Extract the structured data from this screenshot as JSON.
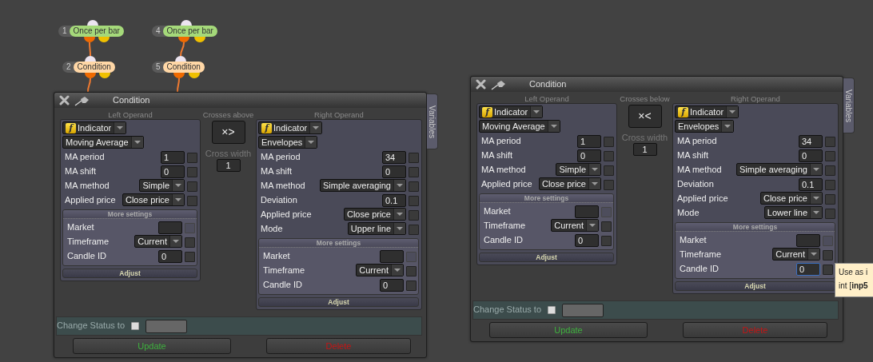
{
  "nodes": [
    {
      "number": "1",
      "label": "Once per bar",
      "kind": "trigger"
    },
    {
      "number": "2",
      "label": "Condition",
      "kind": "condition"
    },
    {
      "number": "4",
      "label": "Once per bar",
      "kind": "trigger"
    },
    {
      "number": "5",
      "label": "Condition",
      "kind": "condition"
    }
  ],
  "windows": [
    {
      "title": "Condition",
      "side_tab": "Variables",
      "left_operand": {
        "heading": "Left Operand",
        "source": {
          "icon": "f",
          "value": "Indicator"
        },
        "indicator": "Moving Average",
        "params": [
          {
            "label": "MA period",
            "kind": "number",
            "value": "1",
            "checked": false
          },
          {
            "label": "MA shift",
            "kind": "number",
            "value": "0",
            "checked": false
          },
          {
            "label": "MA method",
            "kind": "select",
            "value": "Simple",
            "checked": false
          },
          {
            "label": "Applied price",
            "kind": "select",
            "value": "Close price",
            "checked": false
          }
        ],
        "more_settings": {
          "heading": "More settings",
          "params": [
            {
              "label": "Market",
              "kind": "symbol",
              "checked": false,
              "focused": false
            },
            {
              "label": "Timeframe",
              "kind": "select",
              "value": "Current",
              "checked": false,
              "focused": false
            },
            {
              "label": "Candle ID",
              "kind": "number",
              "value": "0",
              "checked": false,
              "focused": false
            }
          ]
        },
        "adjust": "Adjust"
      },
      "operator": {
        "caption": "Crosses above",
        "symbol": "×>"
      },
      "cross_width": {
        "label": "Cross width",
        "value": "1"
      },
      "right_operand": {
        "heading": "Right Operand",
        "source": {
          "icon": "f",
          "value": "Indicator"
        },
        "indicator": "Envelopes",
        "params": [
          {
            "label": "MA period",
            "kind": "number",
            "value": "34",
            "checked": false
          },
          {
            "label": "MA shift",
            "kind": "number",
            "value": "0",
            "checked": false
          },
          {
            "label": "MA method",
            "kind": "select",
            "value": "Simple averaging",
            "checked": false
          },
          {
            "label": "Deviation",
            "kind": "number",
            "value": "0.1",
            "checked": false
          },
          {
            "label": "Applied price",
            "kind": "select",
            "value": "Close price",
            "checked": false
          },
          {
            "label": "Mode",
            "kind": "select",
            "value": "Upper line",
            "checked": false
          }
        ],
        "more_settings": {
          "heading": "More settings",
          "params": [
            {
              "label": "Market",
              "kind": "symbol",
              "checked": false,
              "focused": false
            },
            {
              "label": "Timeframe",
              "kind": "select",
              "value": "Current",
              "checked": false,
              "focused": false
            },
            {
              "label": "Candle ID",
              "kind": "number",
              "value": "0",
              "checked": false,
              "focused": false
            }
          ]
        },
        "adjust": "Adjust"
      },
      "status": {
        "label": "Change Status to",
        "checked": false
      },
      "buttons": [
        {
          "label": "Update",
          "kind": "update"
        },
        {
          "label": "Delete",
          "kind": "delete"
        }
      ]
    },
    {
      "title": "Condition",
      "side_tab": "Variables",
      "left_operand": {
        "heading": "Left Operand",
        "source": {
          "icon": "f",
          "value": "Indicator"
        },
        "indicator": "Moving Average",
        "params": [
          {
            "label": "MA period",
            "kind": "number",
            "value": "1",
            "checked": false
          },
          {
            "label": "MA shift",
            "kind": "number",
            "value": "0",
            "checked": false
          },
          {
            "label": "MA method",
            "kind": "select",
            "value": "Simple",
            "checked": false
          },
          {
            "label": "Applied price",
            "kind": "select",
            "value": "Close price",
            "checked": false
          }
        ],
        "more_settings": {
          "heading": "More settings",
          "params": [
            {
              "label": "Market",
              "kind": "symbol",
              "checked": false,
              "focused": false
            },
            {
              "label": "Timeframe",
              "kind": "select",
              "value": "Current",
              "checked": false,
              "focused": false
            },
            {
              "label": "Candle ID",
              "kind": "number",
              "value": "0",
              "checked": false,
              "focused": false
            }
          ]
        },
        "adjust": "Adjust"
      },
      "operator": {
        "caption": "Crosses below",
        "symbol": "×<"
      },
      "cross_width": {
        "label": "Cross width",
        "value": "1"
      },
      "right_operand": {
        "heading": "Right Operand",
        "source": {
          "icon": "f",
          "value": "Indicator"
        },
        "indicator": "Envelopes",
        "params": [
          {
            "label": "MA period",
            "kind": "number",
            "value": "34",
            "checked": false
          },
          {
            "label": "MA shift",
            "kind": "number",
            "value": "0",
            "checked": false
          },
          {
            "label": "MA method",
            "kind": "select",
            "value": "Simple averaging",
            "checked": false
          },
          {
            "label": "Deviation",
            "kind": "number",
            "value": "0.1",
            "checked": false
          },
          {
            "label": "Applied price",
            "kind": "select",
            "value": "Close price",
            "checked": false
          },
          {
            "label": "Mode",
            "kind": "select",
            "value": "Lower line",
            "checked": false
          }
        ],
        "more_settings": {
          "heading": "More settings",
          "params": [
            {
              "label": "Market",
              "kind": "symbol",
              "checked": false,
              "focused": false
            },
            {
              "label": "Timeframe",
              "kind": "select",
              "value": "Current",
              "checked": false,
              "focused": false
            },
            {
              "label": "Candle ID",
              "kind": "number",
              "value": "0",
              "checked": false,
              "focused": true
            }
          ]
        },
        "adjust": "Adjust"
      },
      "status": {
        "label": "Change Status to",
        "checked": false
      },
      "buttons": [
        {
          "label": "Update",
          "kind": "update"
        },
        {
          "label": "Delete",
          "kind": "delete"
        }
      ]
    }
  ],
  "tooltip": {
    "lines": [
      "Use as i",
      "int [**inp5**"
    ]
  }
}
